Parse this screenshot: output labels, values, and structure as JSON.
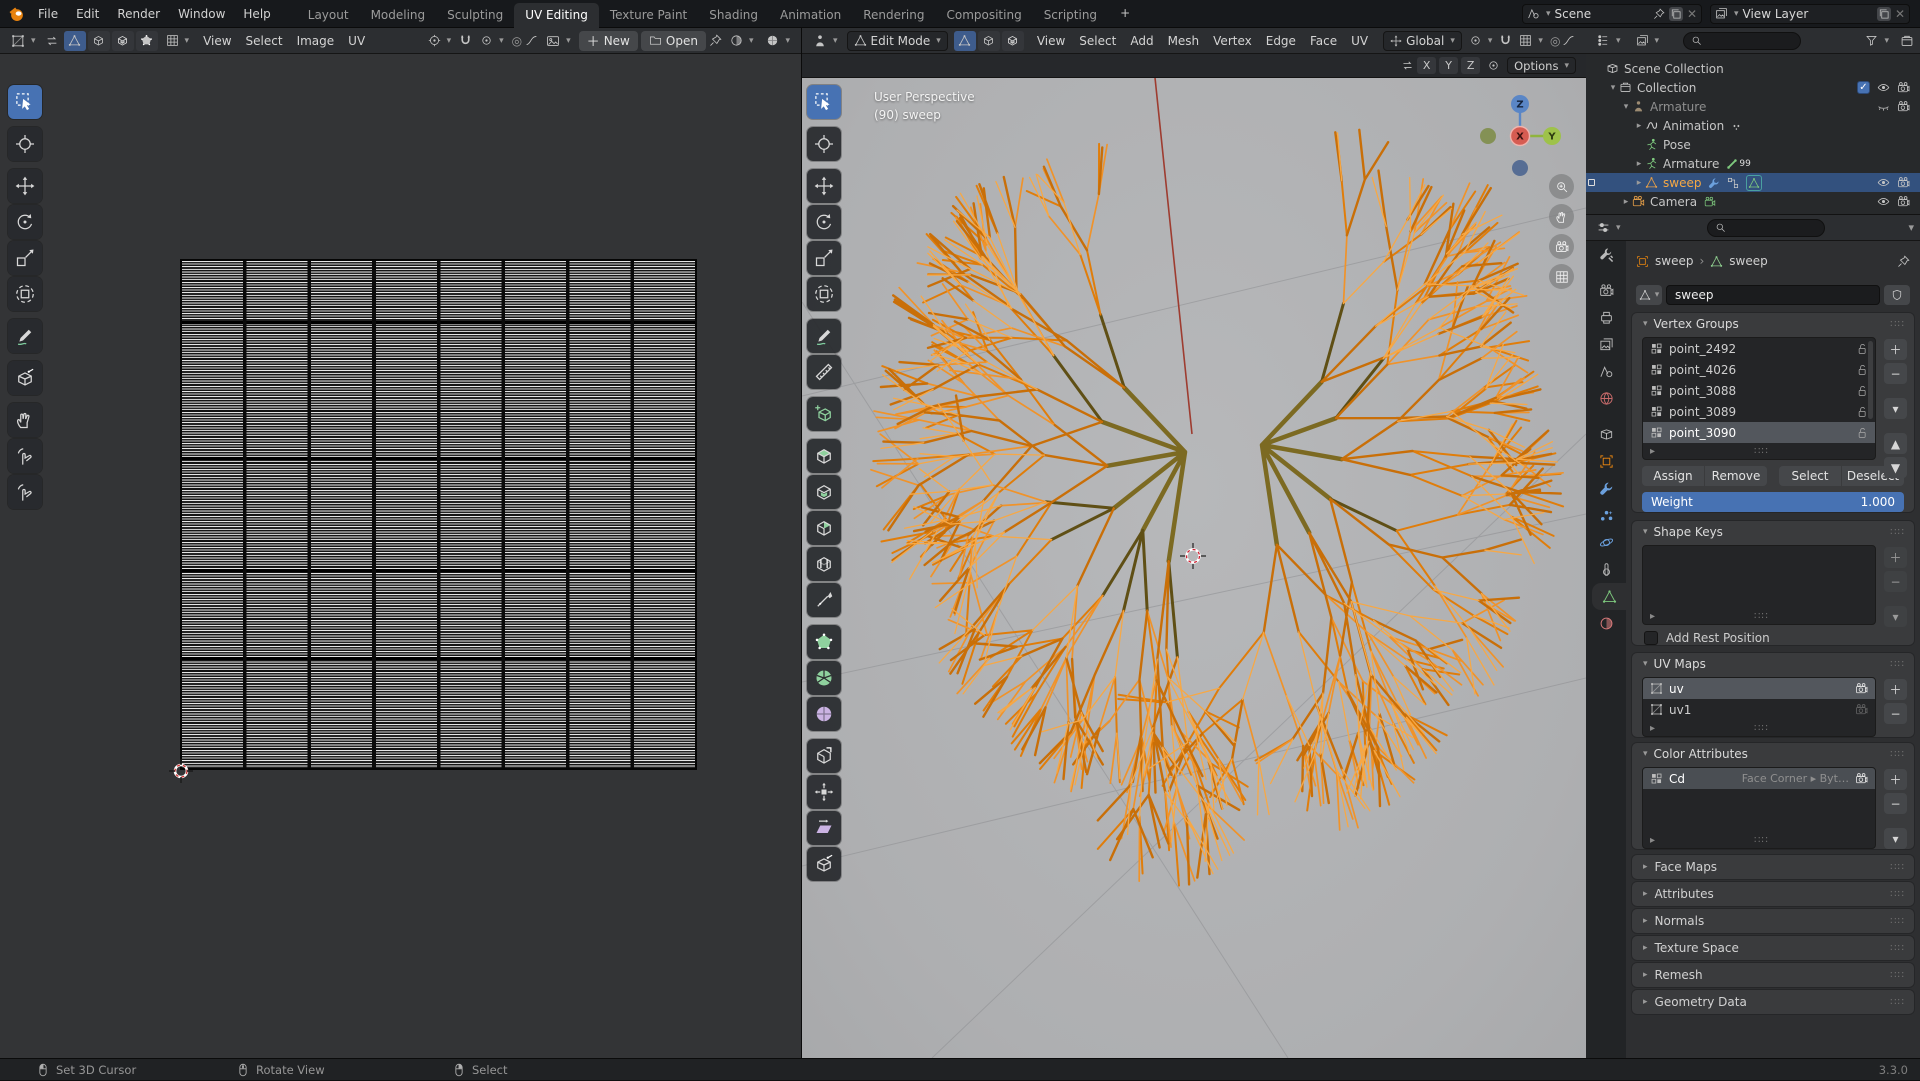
{
  "topbar": {
    "logo_icon": "blender-logo-icon",
    "menus": [
      "File",
      "Edit",
      "Render",
      "Window",
      "Help"
    ],
    "workspaces": [
      "Layout",
      "Modeling",
      "Sculpting",
      "UV Editing",
      "Texture Paint",
      "Shading",
      "Animation",
      "Rendering",
      "Compositing",
      "Scripting"
    ],
    "active_workspace": "UV Editing",
    "add_workspace_label": "+",
    "scene_selector": {
      "icon": "scene-icon",
      "label": "Scene",
      "icons": [
        "pin-icon",
        "copy-icon",
        "close-icon"
      ]
    },
    "view_layer_selector": {
      "icon": "view-layer-icon",
      "label": "View Layer",
      "icons": [
        "copy-icon",
        "close-icon"
      ]
    }
  },
  "uv_editor": {
    "header": {
      "editor_type_icon": "uv-editor-icon",
      "sync_icon": "uv-sync-select-icon",
      "select_modes": [
        "uv-vertex-select-icon",
        "uv-edge-select-icon",
        "uv-face-select-icon",
        "uv-island-select-icon"
      ],
      "sticky_icon": "sticky-select-icon",
      "menus": [
        "View",
        "Select",
        "Image",
        "UV"
      ],
      "pivot_icon": "pivot-point-icon",
      "snap_icon": "snap-magnet-icon",
      "proportional_icon": "proportional-edit-icon",
      "falloff_icon": "falloff-curve-icon",
      "image_icon": "image-browse-icon",
      "new_button": "New",
      "open_button": "Open",
      "pin_icon": "pin-icon"
    },
    "tools": [
      {
        "label": "Select Box",
        "icon": "select-box-icon",
        "active": true
      },
      {
        "label": "2D Cursor",
        "icon": "cursor-icon"
      },
      {
        "label": "Move",
        "icon": "move-icon"
      },
      {
        "label": "Rotate",
        "icon": "rotate-icon"
      },
      {
        "label": "Scale",
        "icon": "scale-icon"
      },
      {
        "label": "Transform",
        "icon": "transform-icon"
      },
      {
        "label": "Annotate",
        "icon": "annotate-icon"
      },
      {
        "label": "Rip Region",
        "icon": "rip-region-icon"
      },
      {
        "label": "Grab",
        "icon": "grab-icon"
      },
      {
        "label": "Relax",
        "icon": "relax-icon"
      },
      {
        "label": "Pinch",
        "icon": "pinch-icon"
      }
    ]
  },
  "viewport": {
    "header": {
      "editor_type_icon": "view3d-editor-icon",
      "mode_icon": "edit-mode-icon",
      "mode": "Edit Mode",
      "select_modes": [
        "vertex-select-icon",
        "edge-select-icon",
        "face-select-icon"
      ],
      "menus": [
        "View",
        "Select",
        "Add",
        "Mesh",
        "Vertex",
        "Edge",
        "Face",
        "UV"
      ],
      "orientation_icon": "orientation-icon",
      "orientation": "Global",
      "snap_icons": [
        "snap-target-icon",
        "snap-magnet-icon",
        "snap-with-icon"
      ],
      "proportional_icon": "proportional-edit-icon",
      "falloff_icon": "falloff-curve-icon",
      "mirror_icon": "mesh-mirror-icon",
      "axis_toggles": [
        "X",
        "Y",
        "Z"
      ],
      "snap_face_icon": "snap-face-nearest-icon",
      "options_label": "Options"
    },
    "overlay": {
      "line1": "User Perspective",
      "line2": "(90) sweep"
    },
    "gizmo_axes": {
      "x": "X",
      "y": "Y",
      "z": "Z"
    },
    "nav_buttons": [
      "zoom-icon",
      "pan-hand-icon",
      "camera-view-icon",
      "ortho-grid-icon"
    ],
    "tools": [
      {
        "label": "Select Box",
        "icon": "select-box-icon",
        "active": true
      },
      {
        "label": "Cursor",
        "icon": "cursor-icon"
      },
      {
        "label": "Move",
        "icon": "move-icon"
      },
      {
        "label": "Rotate",
        "icon": "rotate-icon"
      },
      {
        "label": "Scale",
        "icon": "scale-icon"
      },
      {
        "label": "Transform",
        "icon": "transform-icon"
      },
      {
        "label": "Annotate",
        "icon": "annotate-icon"
      },
      {
        "label": "Measure",
        "icon": "measure-icon"
      },
      {
        "label": "Add Cube",
        "icon": "add-cube-icon"
      },
      {
        "label": "Extrude Region",
        "icon": "extrude-region-icon"
      },
      {
        "label": "Inset Faces",
        "icon": "inset-faces-icon"
      },
      {
        "label": "Bevel",
        "icon": "bevel-icon"
      },
      {
        "label": "Loop Cut",
        "icon": "loop-cut-icon"
      },
      {
        "label": "Knife",
        "icon": "knife-icon"
      },
      {
        "label": "Poly Build",
        "icon": "poly-build-icon"
      },
      {
        "label": "Spin",
        "icon": "spin-icon"
      },
      {
        "label": "Smooth",
        "icon": "smooth-icon"
      },
      {
        "label": "Edge Slide",
        "icon": "edge-slide-icon"
      },
      {
        "label": "Shrink/Fatten",
        "icon": "shrink-fatten-icon"
      },
      {
        "label": "Shear",
        "icon": "shear-icon"
      },
      {
        "label": "Rip Region",
        "icon": "rip-region-icon"
      }
    ]
  },
  "outliner": {
    "header_icons": [
      "outliner-display-icon",
      "filter-funnel-icon",
      "new-collection-icon"
    ],
    "search_placeholder": "",
    "rows": [
      {
        "label": "Scene Collection",
        "icon": "scene-collection-icon",
        "indent": 0,
        "expander": "",
        "toggles": []
      },
      {
        "label": "Collection",
        "icon": "collection-icon",
        "indent": 1,
        "expander": "open",
        "toggles": [
          "checkbox-on",
          "eye",
          "camera"
        ]
      },
      {
        "label": "Armature",
        "icon": "armature-object-icon",
        "indent": 2,
        "expander": "open",
        "dim": true,
        "toggles": [
          "eye-closed",
          "camera"
        ]
      },
      {
        "label": "Animation",
        "icon": "action-icon",
        "indent": 3,
        "expander": "closed",
        "badges": [
          "keyframes-icon"
        ]
      },
      {
        "label": "Pose",
        "icon": "pose-icon",
        "indent": 3,
        "expander": "",
        "badges": []
      },
      {
        "label": "Armature",
        "icon": "armature-data-icon",
        "indent": 3,
        "expander": "closed",
        "badges": [
          "bone-icon"
        ],
        "badge_text": "99"
      },
      {
        "label": "sweep",
        "icon": "mesh-object-icon",
        "indent": 3,
        "expander": "closed",
        "selected": true,
        "active_marker": true,
        "badges": [
          "wrench-icon",
          "nodes-icon",
          "mesh-data-icon"
        ],
        "toggles": [
          "eye",
          "camera"
        ]
      },
      {
        "label": "Camera",
        "icon": "camera-object-icon",
        "indent": 2,
        "expander": "closed",
        "badges": [
          "camera-data-icon"
        ],
        "toggles": [
          "eye",
          "camera"
        ]
      }
    ]
  },
  "properties": {
    "header_icon": "properties-editor-icon",
    "search_placeholder": "",
    "tabs": [
      {
        "icon": "tool-icon",
        "group": false
      },
      {
        "icon": "render-icon",
        "group": true
      },
      {
        "icon": "output-icon"
      },
      {
        "icon": "view-layer-icon"
      },
      {
        "icon": "scene-icon"
      },
      {
        "icon": "world-icon"
      },
      {
        "icon": "collection-props-icon",
        "group": true
      },
      {
        "icon": "object-props-icon"
      },
      {
        "icon": "modifiers-icon"
      },
      {
        "icon": "particles-icon"
      },
      {
        "icon": "physics-icon"
      },
      {
        "icon": "constraints-icon"
      },
      {
        "icon": "object-data-icon",
        "active": true
      },
      {
        "icon": "material-icon"
      }
    ],
    "breadcrumb": {
      "object_icon": "object-props-icon",
      "object": "sweep",
      "separator": "›",
      "data_icon": "mesh-data-icon",
      "data": "sweep",
      "pin_icon": "pin-icon"
    },
    "name_field": {
      "icon": "mesh-data-icon",
      "value": "sweep",
      "shield_icon": "fake-user-shield-icon"
    },
    "vertex_groups": {
      "title": "Vertex Groups",
      "items": [
        "point_2492",
        "point_4026",
        "point_3088",
        "point_3089",
        "point_3090"
      ],
      "selected": "point_3090",
      "item_icon": "vertex-group-icon",
      "lock_icon": "lock-open-icon",
      "side_buttons": [
        "add",
        "remove",
        "specials",
        "move-up",
        "move-down"
      ],
      "buttons": [
        "Assign",
        "Remove",
        "Select",
        "Deselect"
      ],
      "weight_label": "Weight",
      "weight_value": "1.000"
    },
    "shape_keys": {
      "title": "Shape Keys",
      "items": [],
      "add_rest_position_label": "Add Rest Position",
      "add_rest_position_checked": false
    },
    "uv_maps": {
      "title": "UV Maps",
      "items": [
        {
          "name": "uv",
          "selected": true,
          "render_icon": "camera-render-on-icon"
        },
        {
          "name": "uv1",
          "selected": false,
          "render_icon": "camera-render-off-icon"
        }
      ]
    },
    "color_attributes": {
      "title": "Color Attributes",
      "items": [
        {
          "name": "Cd",
          "domain": "Face Corner ▸ Byt…",
          "render_icon": "camera-render-on-icon"
        }
      ]
    },
    "collapsed_sections": [
      "Face Maps",
      "Attributes",
      "Normals",
      "Texture Space",
      "Remesh",
      "Geometry Data"
    ]
  },
  "status_bar": {
    "hints": [
      {
        "icon": "mouse-left-icon",
        "label": "Set 3D Cursor"
      },
      {
        "icon": "mouse-middle-icon",
        "label": "Rotate View"
      },
      {
        "icon": "mouse-right-icon",
        "label": "Select"
      }
    ],
    "version": "3.3.0"
  },
  "colors": {
    "accent_blue": "#4772b3",
    "selection_row_blue": "#33517e",
    "object_orange": "#e8850f",
    "data_green": "#6fbf6f",
    "modifier_blue": "#6ba0dd",
    "material_pink": "#d97b7b",
    "world_red": "#c66a6a"
  }
}
